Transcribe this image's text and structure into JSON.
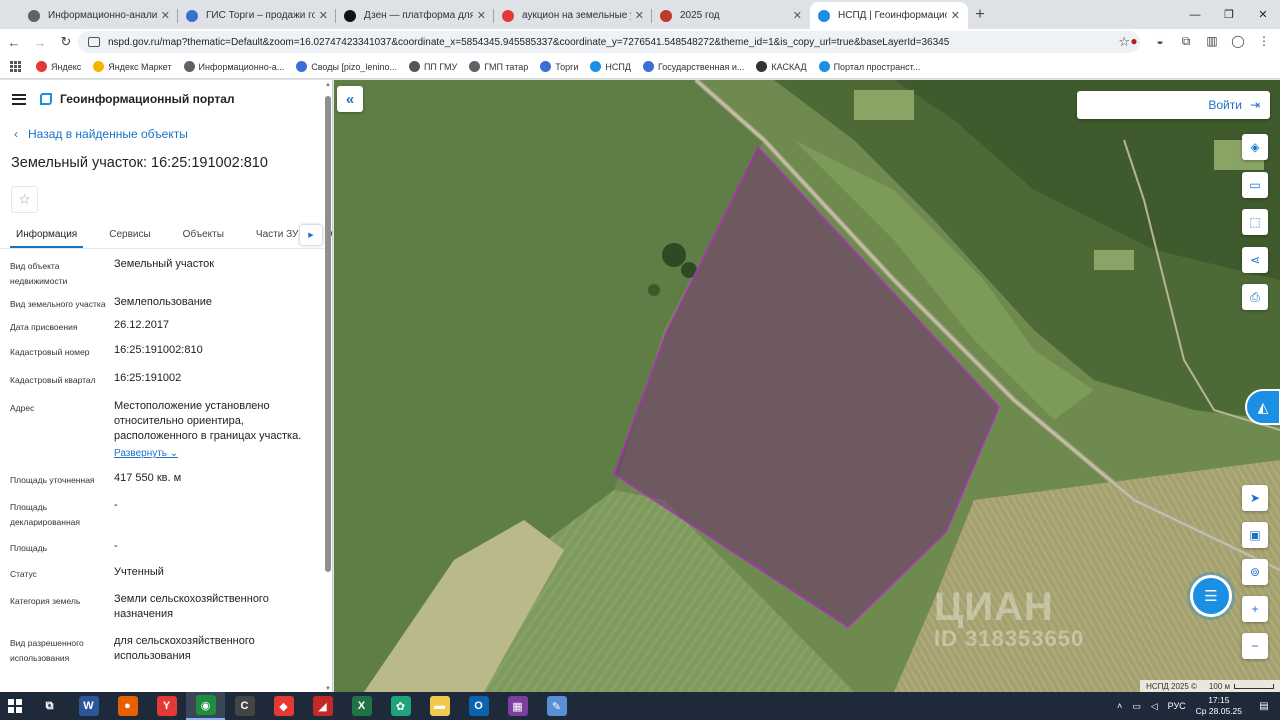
{
  "browser": {
    "tabs": [
      {
        "label": "Информационно-аналитичес",
        "active": false,
        "favicon_color": "#5f6368"
      },
      {
        "label": "ГИС Торги – продажи государ",
        "active": false,
        "favicon_color": "#3b6fd6"
      },
      {
        "label": "Дзен — платформа для прос",
        "active": false,
        "favicon_color": "#111111"
      },
      {
        "label": "аукцион на земельные участ",
        "active": false,
        "favicon_color": "#e53935"
      },
      {
        "label": "2025 год",
        "active": false,
        "favicon_color": "#c0392b"
      },
      {
        "label": "НСПД | Геоинформационный",
        "active": true,
        "favicon_color": "#1a8fe3"
      }
    ],
    "tab_close": "✕",
    "new_tab": "+",
    "window_controls": {
      "minimize": "—",
      "maximize": "❐",
      "close": "✕"
    },
    "nav": {
      "back": "←",
      "forward": "→",
      "reload": "↻"
    },
    "url": "nspd.gov.ru/map?thematic=Default&zoom=16.02747423341037&coordinate_x=5854345.945585337&coordinate_y=7276541.548548272&theme_id=1&is_copy_url=true&baseLayerId=36345",
    "bookmarks": [
      {
        "label": "Яндекс",
        "color": "#e53935"
      },
      {
        "label": "Яндекс Маркет",
        "color": "#f4b400"
      },
      {
        "label": "Информационно-а...",
        "color": "#5f6368"
      },
      {
        "label": "Своды [pizo_lenino...",
        "color": "#3b6fd6"
      },
      {
        "label": "ПП ГМУ",
        "color": "#555555"
      },
      {
        "label": "ГМП татар",
        "color": "#5f6368"
      },
      {
        "label": "Торги",
        "color": "#3b6fd6"
      },
      {
        "label": "НСПД",
        "color": "#1a8fe3"
      },
      {
        "label": "Государственная и...",
        "color": "#3b6fd6"
      },
      {
        "label": "КАСКАД",
        "color": "#333333"
      },
      {
        "label": "Портал пространст...",
        "color": "#1a8fe3"
      }
    ]
  },
  "panel": {
    "portal_title": "Геоинформационный портал",
    "back_link": "Назад в найденные объекты",
    "object_title": "Земельный участок: 16:25:191002:810",
    "favorite_icon": "☆",
    "tabs": [
      "Информация",
      "Сервисы",
      "Объекты",
      "Части ЗУ",
      "Сост"
    ],
    "properties": [
      {
        "label": "Вид объекта недвижимости",
        "value": "Земельный участок"
      },
      {
        "label": "Вид земельного участка",
        "value": "Землепользование"
      },
      {
        "label": "Дата присвоения",
        "value": "26.12.2017"
      },
      {
        "label": "Кадастровый номер",
        "value": "16:25:191002:810"
      },
      {
        "label": "Кадастровый квартал",
        "value": "16:25:191002"
      },
      {
        "label": "Адрес",
        "value": "Местоположение установлено относительно ориентира, расположенного в границах участка.",
        "link": "Развернуть"
      },
      {
        "label": "Площадь уточненная",
        "value": "417 550 кв. м"
      },
      {
        "label": "Площадь декларированная",
        "value": "-"
      },
      {
        "label": "Площадь",
        "value": "-"
      },
      {
        "label": "Статус",
        "value": "Учтенный"
      },
      {
        "label": "Категория земель",
        "value": "Земли сельскохозяйственного назначения"
      },
      {
        "label": "Вид разрешенного использования",
        "value": "для сельскохозяйственного использования"
      }
    ]
  },
  "map": {
    "login_label": "Войти",
    "watermark_brand": "ЦИАН",
    "watermark_id": "ID 318353650",
    "attribution": "НСПД 2025 ©",
    "scale_label": "100 м",
    "parcel_color": "#b030c0",
    "tools_top": [
      "layers-icon",
      "ruler-icon",
      "select-area-icon",
      "share-icon",
      "print-icon"
    ],
    "tools_bottom": [
      "locate-icon",
      "minimap-icon",
      "geo-search-icon",
      "zoom-in-icon",
      "zoom-out-icon"
    ]
  },
  "taskbar": {
    "language": "РУС",
    "time": "17:15",
    "date": "Ср 28.05.25",
    "apps": [
      {
        "name": "task-view",
        "glyph": "⧉",
        "color": "#1e2a3a"
      },
      {
        "name": "word",
        "glyph": "W",
        "color": "#2b579a"
      },
      {
        "name": "firefox",
        "glyph": "●",
        "color": "#e66000"
      },
      {
        "name": "yandex-browser",
        "glyph": "Y",
        "color": "#e53935"
      },
      {
        "name": "chrome",
        "glyph": "◉",
        "color": "#1e8e3e"
      },
      {
        "name": "app-c",
        "glyph": "C",
        "color": "#444444"
      },
      {
        "name": "anydesk",
        "glyph": "◆",
        "color": "#e53935"
      },
      {
        "name": "app-red",
        "glyph": "◢",
        "color": "#c62828"
      },
      {
        "name": "excel",
        "glyph": "X",
        "color": "#217346"
      },
      {
        "name": "app-green",
        "glyph": "✿",
        "color": "#1fa37a"
      },
      {
        "name": "explorer",
        "glyph": "▬",
        "color": "#f2c94c"
      },
      {
        "name": "outlook",
        "glyph": "O",
        "color": "#0a64ad"
      },
      {
        "name": "winrar",
        "glyph": "▦",
        "color": "#7b3fa0"
      },
      {
        "name": "notes",
        "glyph": "✎",
        "color": "#5a8fd6"
      }
    ]
  }
}
